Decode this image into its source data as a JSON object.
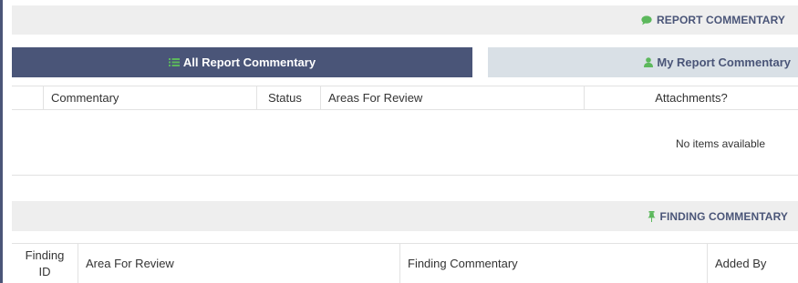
{
  "report_commentary": {
    "header_title": "REPORT COMMENTARY",
    "header_icon": "comment-icon",
    "tabs": [
      {
        "label": "All Report Commentary",
        "icon": "list-icon",
        "active": true
      },
      {
        "label": "My Report Commentary",
        "icon": "user-icon",
        "active": false
      }
    ],
    "columns": [
      "",
      "Commentary",
      "Status",
      "Areas For Review",
      "Attachments?"
    ],
    "empty_message": "No items available"
  },
  "finding_commentary": {
    "header_title": "FINDING COMMENTARY",
    "header_icon": "pin-icon",
    "columns": [
      "Finding ID",
      "Area For Review",
      "Finding Commentary",
      "Added By"
    ]
  },
  "colors": {
    "navy": "#4a5578",
    "green_icon": "#5cb85c",
    "header_bg": "#eeeeee",
    "inactive_tab_bg": "#d9e0e6"
  }
}
